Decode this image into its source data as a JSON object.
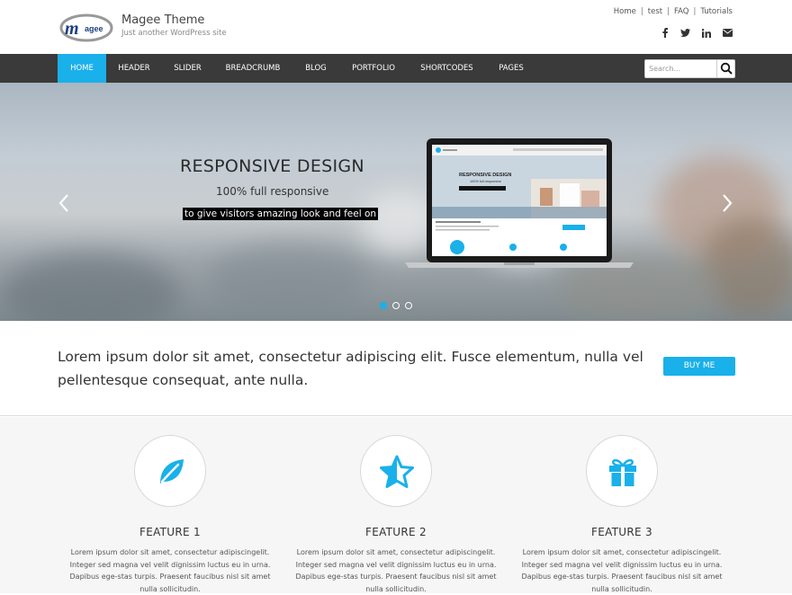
{
  "site": {
    "logo_text": "agee",
    "title": "Magee Theme",
    "tagline": "Just another WordPress site"
  },
  "top_links": [
    "Home",
    "test",
    "FAQ",
    "Tutorials"
  ],
  "social": [
    "facebook-icon",
    "twitter-icon",
    "linkedin-icon",
    "envelope-icon"
  ],
  "nav": {
    "items": [
      {
        "label": "HOME",
        "active": true
      },
      {
        "label": "HEADER"
      },
      {
        "label": "SLIDER"
      },
      {
        "label": "BREADCRUMB"
      },
      {
        "label": "BLOG"
      },
      {
        "label": "PORTFOLIO"
      },
      {
        "label": "SHORTCODES"
      },
      {
        "label": "PAGES"
      }
    ],
    "search_placeholder": "Search..."
  },
  "hero": {
    "heading": "RESPONSIVE DESIGN",
    "subheading": "100% full responsive",
    "tagline": "to give visitors amazing look and feel on",
    "screen_heading": "RESPONSIVE DESIGN",
    "screen_sub": "100% full responsive",
    "slides": 3,
    "active_slide": 1
  },
  "cta": {
    "text": "Lorem ipsum dolor sit amet, consectetur adipiscing elit. Fusce elementum, nulla vel pellentesque consequat, ante nulla.",
    "button": "BUY ME"
  },
  "features": [
    {
      "title": "FEATURE 1",
      "icon": "leaf-icon",
      "desc": "Lorem ipsum dolor sit amet, consectetur adipiscingelit. Integer sed magna vel velit dignissim luctus eu in urna. Dapibus ege-stas turpis. Praesent faucibus nisl sit amet nulla sollicitudin."
    },
    {
      "title": "FEATURE 2",
      "icon": "star-icon",
      "desc": "Lorem ipsum dolor sit amet, consectetur adipiscingelit. Integer sed magna vel velit dignissim luctus eu in urna. Dapibus ege-stas turpis. Praesent faucibus nisl sit amet nulla sollicitudin."
    },
    {
      "title": "FEATURE 3",
      "icon": "gift-icon",
      "desc": "Lorem ipsum dolor sit amet, consectetur adipiscingelit. Integer sed magna vel velit dignissim luctus eu in urna. Dapibus ege-stas turpis. Praesent faucibus nisl sit amet nulla sollicitudin."
    }
  ],
  "colors": {
    "accent": "#1ab0ea",
    "navbar": "#3a3a3a"
  }
}
